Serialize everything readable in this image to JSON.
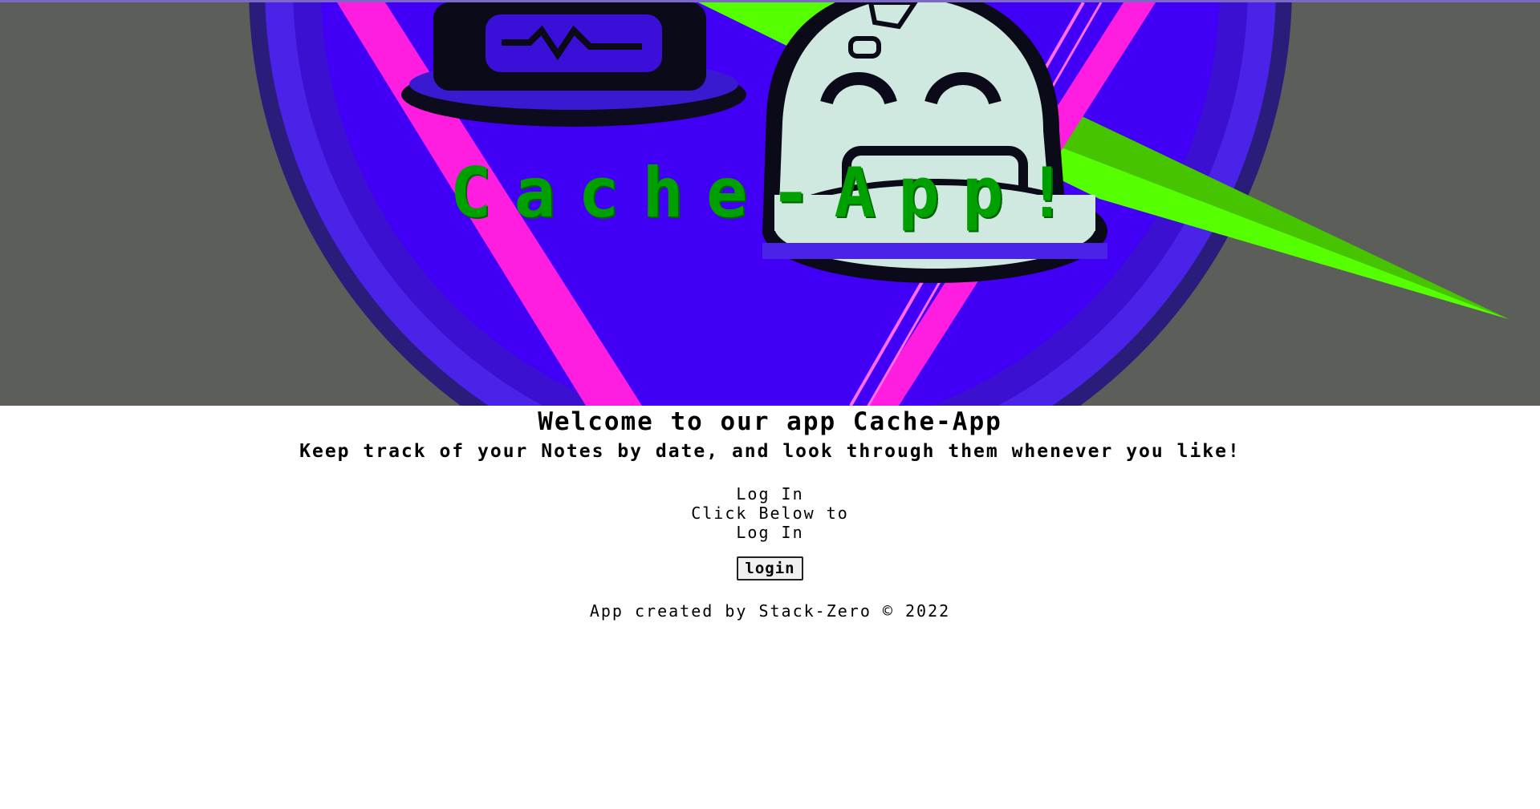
{
  "hero": {
    "title": "Cache-App!",
    "image": "robot-logo-graphic"
  },
  "main": {
    "welcome": "Welcome to our app Cache-App",
    "tagline": "Keep track of your Notes by date, and look through them whenever you like!",
    "login_heading": "Log In",
    "login_sub": "Click Below to Log In",
    "login_button": "login"
  },
  "footer": {
    "text": "App created by Stack-Zero © 2022"
  },
  "colors": {
    "title_green": "#00a000",
    "purple": "#3a00f0",
    "magenta": "#ff1ee0",
    "lime": "#55ff00"
  }
}
